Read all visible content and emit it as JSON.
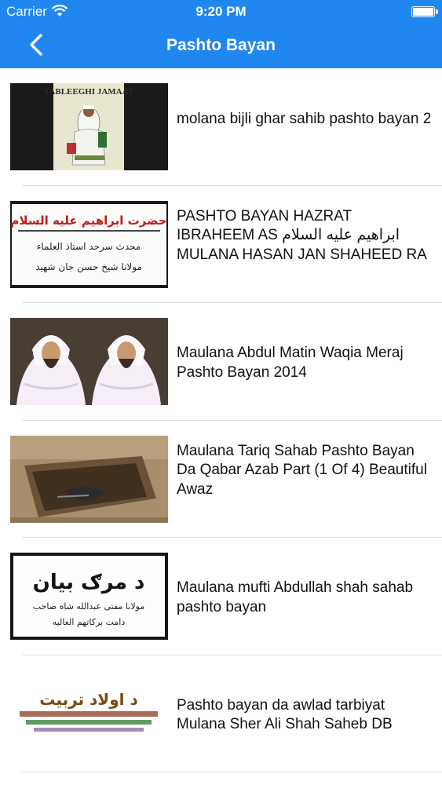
{
  "status_bar": {
    "carrier": "Carrier",
    "time": "9:20 PM",
    "wifi_icon": "wifi-icon",
    "battery_level": 1.0
  },
  "nav_bar": {
    "title": "Pashto Bayan",
    "back_icon": "chevron-left-icon",
    "background_color": "#1f87ef"
  },
  "thumbnails": {
    "item1": {
      "caption": "TABLEEGHI JAMAAT"
    },
    "item2": {
      "line1": "حضرت ابراهیم علیه السلام",
      "line2": "محدث سرحد استاذ العلماء",
      "line3": "مولانا شیخ حسن جان شهید"
    },
    "item5": {
      "line1": "د مرګ بیان",
      "line2": "مولانا مفتی عبدالله شاه صاحب",
      "line3": "دامت برکاتهم العالیه"
    },
    "item6": {
      "line1": "د اولاد تربیت"
    }
  },
  "videos": [
    {
      "title": "molana bijli ghar sahib pashto bayan 2"
    },
    {
      "title": "PASHTO BAYAN HAZRAT IBRAHEEM AS ابراهیم علیه السلام MULANA HASAN JAN SHAHEED RA"
    },
    {
      "title": "Maulana Abdul Matin Waqia Meraj Pashto Bayan 2014"
    },
    {
      "title": "Maulana Tariq Sahab Pashto Bayan Da Qabar Azab Part (1 Of 4) Beautiful Awaz"
    },
    {
      "title": "Maulana mufti Abdullah shah sahab pashto bayan"
    },
    {
      "title": "Pashto bayan da awlad tarbiyat Mulana Sher Ali Shah Saheb DB"
    }
  ]
}
